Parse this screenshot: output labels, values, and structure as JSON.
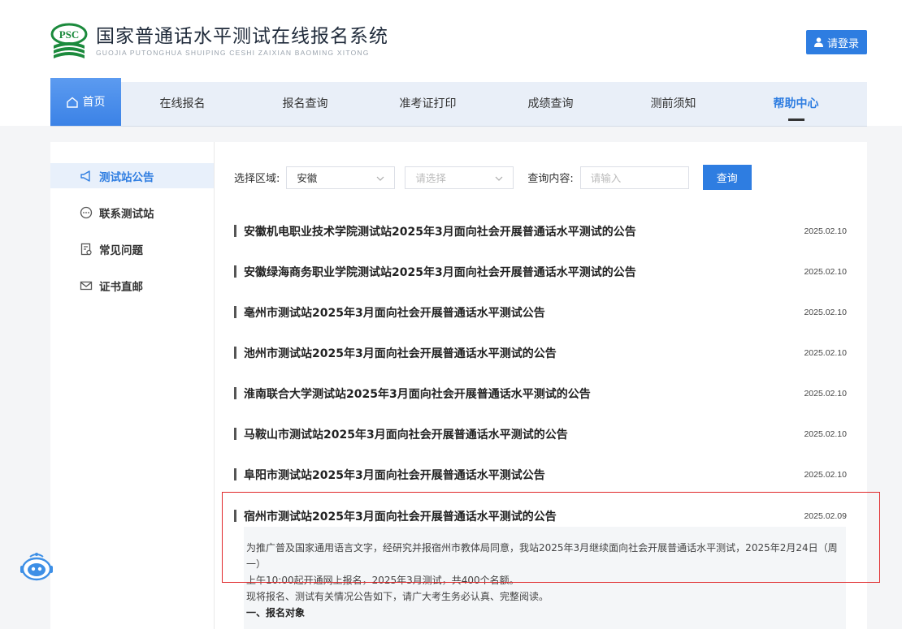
{
  "header": {
    "logo_badge": "PSC",
    "title": "国家普通话水平测试在线报名系统",
    "subtitle": "GUOJIA PUTONGHUA SHUIPING CESHI ZAIXIAN BAOMING XITONG",
    "login_label": "请登录"
  },
  "nav": {
    "items": [
      {
        "label": "首页"
      },
      {
        "label": "在线报名"
      },
      {
        "label": "报名查询"
      },
      {
        "label": "准考证打印"
      },
      {
        "label": "成绩查询"
      },
      {
        "label": "测前须知"
      },
      {
        "label": "帮助中心"
      }
    ]
  },
  "sidebar": {
    "items": [
      {
        "label": "测试站公告",
        "icon": "megaphone-icon"
      },
      {
        "label": "联系测试站",
        "icon": "chat-icon"
      },
      {
        "label": "常见问题",
        "icon": "document-question-icon"
      },
      {
        "label": "证书直邮",
        "icon": "mail-icon"
      }
    ]
  },
  "filter": {
    "region_label": "选择区域:",
    "region_value": "安徽",
    "second_placeholder": "请选择",
    "query_label": "查询内容:",
    "query_placeholder": "请输入",
    "query_button": "查询"
  },
  "announcements": [
    {
      "title": "安徽机电职业技术学院测试站2025年3月面向社会开展普通话水平测试的公告",
      "date": "2025.02.10"
    },
    {
      "title": "安徽绿海商务职业学院测试站2025年3月面向社会开展普通话水平测试的公告",
      "date": "2025.02.10"
    },
    {
      "title": "亳州市测试站2025年3月面向社会开展普通话水平测试公告",
      "date": "2025.02.10"
    },
    {
      "title": "池州市测试站2025年3月面向社会开展普通话水平测试的公告",
      "date": "2025.02.10"
    },
    {
      "title": "淮南联合大学测试站2025年3月面向社会开展普通话水平测试的公告",
      "date": "2025.02.10"
    },
    {
      "title": "马鞍山市测试站2025年3月面向社会开展普通话水平测试的公告",
      "date": "2025.02.10"
    },
    {
      "title": "阜阳市测试站2025年3月面向社会开展普通话水平测试公告",
      "date": "2025.02.10"
    },
    {
      "title": "宿州市测试站2025年3月面向社会开展普通话水平测试的公告",
      "date": "2025.02.09"
    }
  ],
  "expanded": {
    "line1": "为推广普及国家通用语言文字，经研究并报宿州市教体局同意，我站2025年3月继续面向社会开展普通话水平测试，2025年2月24日（周一）",
    "line2": "上午10:00起开通网上报名，2025年3月测试，共400个名额。",
    "line3": "现将报名、测试有关情况公告如下，请广大考生务必认真、完整阅读。",
    "line4": "一、报名对象"
  },
  "colors": {
    "primary": "#2e7de1",
    "highlight_border": "#e0282a",
    "nav_bg": "#e9eff8"
  }
}
